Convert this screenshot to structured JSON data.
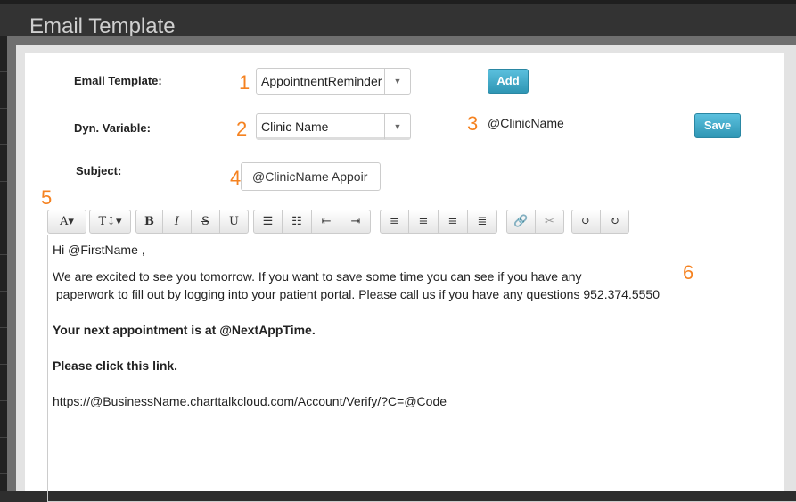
{
  "header": {
    "title": "Email Template"
  },
  "form": {
    "template_label": "Email Template:",
    "template_value": "AppointnentReminder",
    "add_label": "Add",
    "dyn_label": "Dyn. Variable:",
    "dyn_value": "Clinic Name",
    "dyn_token": "@ClinicName",
    "save_label": "Save",
    "subject_label": "Subject:",
    "subject_value": "@ClinicName Appoir"
  },
  "annotations": [
    "1",
    "2",
    "3",
    "4",
    "5",
    "6"
  ],
  "annotation_color": "#f58220",
  "button_color": "#49afcd",
  "toolbar": [
    {
      "group": "font",
      "items": [
        {
          "icon": "font-color-icon",
          "glyph": "A▾"
        }
      ]
    },
    {
      "group": "size",
      "items": [
        {
          "icon": "font-size-icon",
          "glyph": "T↕▾"
        }
      ]
    },
    {
      "group": "style",
      "items": [
        {
          "icon": "bold-icon",
          "glyph": "B"
        },
        {
          "icon": "italic-icon",
          "glyph": "I"
        },
        {
          "icon": "strikethrough-icon",
          "glyph": "S"
        },
        {
          "icon": "underline-icon",
          "glyph": "U"
        }
      ]
    },
    {
      "group": "list",
      "items": [
        {
          "icon": "bullet-list-icon",
          "glyph": "☰"
        },
        {
          "icon": "numbered-list-icon",
          "glyph": "☷"
        },
        {
          "icon": "outdent-icon",
          "glyph": "⇤"
        },
        {
          "icon": "indent-icon",
          "glyph": "⇥"
        }
      ]
    },
    {
      "group": "align",
      "items": [
        {
          "icon": "align-left-icon",
          "glyph": "≡"
        },
        {
          "icon": "align-center-icon",
          "glyph": "≡"
        },
        {
          "icon": "align-right-icon",
          "glyph": "≡"
        },
        {
          "icon": "justify-icon",
          "glyph": "≣"
        }
      ]
    },
    {
      "group": "link",
      "items": [
        {
          "icon": "link-icon",
          "glyph": "🔗"
        },
        {
          "icon": "unlink-icon",
          "glyph": "✂"
        }
      ]
    },
    {
      "group": "history",
      "items": [
        {
          "icon": "undo-icon",
          "glyph": "↺"
        },
        {
          "icon": "redo-icon",
          "glyph": "↻"
        }
      ]
    }
  ],
  "body": {
    "greeting": "Hi @FirstName ,",
    "line1": "We are excited to see you tomorrow.  If you want to save some time you can see if you have any",
    "line2": " paperwork to fill out by logging into your patient portal. Please call us if you have any questions 952.374.5550",
    "appointment": "Your next appointment is at @NextAppTime.",
    "click": "Please click this link.",
    "link": "https://@BusinessName.charttalkcloud.com/Account/Verify/?C=@Code"
  }
}
